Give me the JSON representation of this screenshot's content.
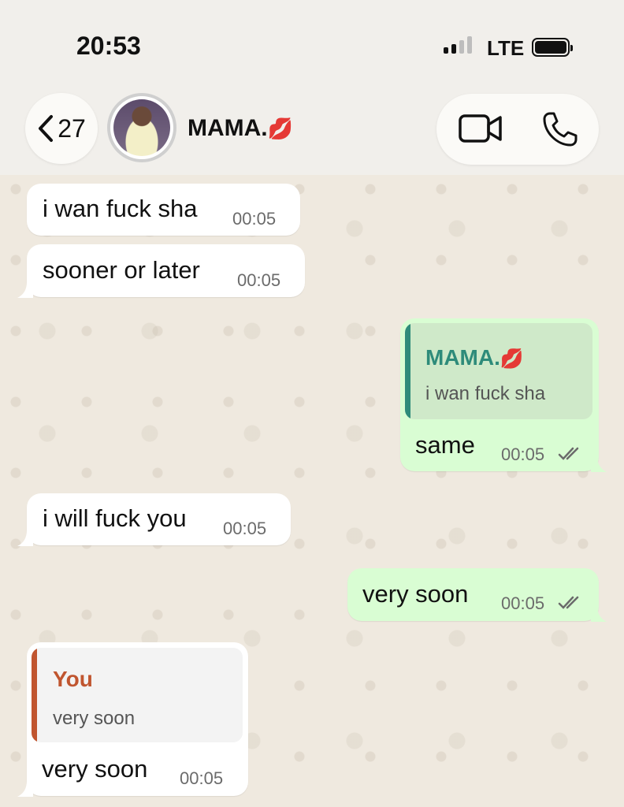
{
  "status_bar": {
    "time": "20:53",
    "network": "LTE"
  },
  "header": {
    "back_count": "27",
    "contact_name": "MAMA.",
    "contact_emoji": "💋"
  },
  "colors": {
    "incoming_bubble": "#ffffff",
    "outgoing_bubble": "#d9fdd3",
    "quote_green_accent": "#2e8b7a",
    "quote_orange_accent": "#c0552f",
    "chat_background": "#efe9df"
  },
  "icons": {
    "back": "chevron-left-icon",
    "video": "video-camera-icon",
    "phone": "phone-icon",
    "read_receipt": "double-check-icon"
  },
  "messages": [
    {
      "direction": "in",
      "text": "i wan fuck sha",
      "time": "00:05"
    },
    {
      "direction": "in",
      "text": "sooner or later",
      "time": "00:05"
    },
    {
      "direction": "out",
      "quote_author": "MAMA.",
      "quote_emoji": "💋",
      "quote_text": "i wan fuck sha",
      "text": "same",
      "time": "00:05"
    },
    {
      "direction": "in",
      "text": "i will fuck you",
      "time": "00:05"
    },
    {
      "direction": "out",
      "text": "very soon",
      "time": "00:05"
    },
    {
      "direction": "in",
      "quote_author": "You",
      "quote_text": "very soon",
      "text": "very soon",
      "time": "00:05"
    }
  ]
}
